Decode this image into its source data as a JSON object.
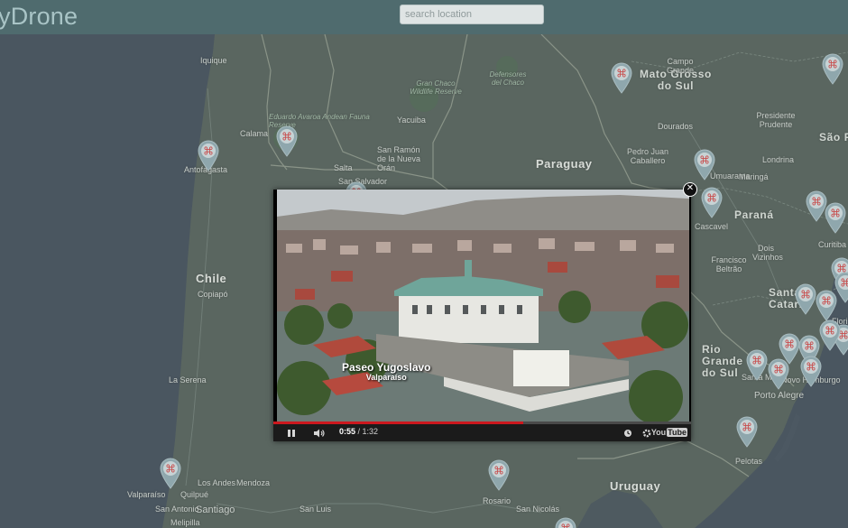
{
  "app": {
    "logo_text": "yDrone"
  },
  "search": {
    "placeholder": "search location",
    "value": ""
  },
  "map": {
    "labels": {
      "paraguay": "Paraguay",
      "chile": "Chile",
      "uruguay": "Uruguay",
      "parana": "Paraná",
      "rio_grande_do_sul": "Rio Grande do Sul",
      "santa_catarina": "Santa Catarin",
      "mato_grosso_do_sul": "Mato Grosso do Sul",
      "sao_paulo": "São Pa",
      "iquique": "Iquique",
      "calama": "Calama",
      "antofagasta": "Antofagasta",
      "copiapo": "Copiapó",
      "la_serena": "La Serena",
      "valparaiso": "Valparaíso",
      "quilpue": "Quilpué",
      "san_antonio": "San Antonio",
      "santiago": "Santiago",
      "melipilla": "Melipilla",
      "los_andes": "Los Andes",
      "mendoza": "Mendoza",
      "san_luis": "San Luis",
      "rosario": "Rosario",
      "san_nicolas": "San Nicolás",
      "yacuiba": "Yacuiba",
      "salta": "Salta",
      "san_salvador_de_jujuy": "San Salvador",
      "san_ramon": "San Ramón de la Nueva Orán",
      "eduardo_avaroa": "Eduardo Avaroa Andean Fauna",
      "reserve": "Reserve",
      "gran_chaco": "Gran Chaco Wildlife Reserve",
      "defensores": "Defensores del Chaco",
      "campo_grande": "Campo Grande",
      "dourados": "Dourados",
      "pedro_juan": "Pedro Juan Caballero",
      "maringa": "Maringá",
      "londrina": "Londrina",
      "umuarama": "Umuarama",
      "presidente_prudente": "Presidente Prudente",
      "cascavel": "Cascavel",
      "francisco_beltrao": "Francisco Beltrão",
      "dois_vizinhos": "Dois Vizinhos",
      "curitiba": "Curitiba",
      "santa_maria": "Santa Maria",
      "novo_hamburgo": "Novo Hamburgo",
      "porto_alegre": "Porto Alegre",
      "pelotas": "Pelotas",
      "flori": "Flori"
    }
  },
  "video": {
    "caption_title": "Paseo Yugoslavo",
    "caption_subtitle": "Valparaíso",
    "time_current": "0:55",
    "time_total": "/ 1:32",
    "progress": 0.598,
    "youtube_label": "You",
    "youtube_tube": "Tube"
  },
  "controls": {
    "close_glyph": "✕",
    "icons": [
      "pause-icon",
      "volume-icon",
      "watch-later-icon",
      "settings-icon",
      "youtube-logo"
    ]
  }
}
